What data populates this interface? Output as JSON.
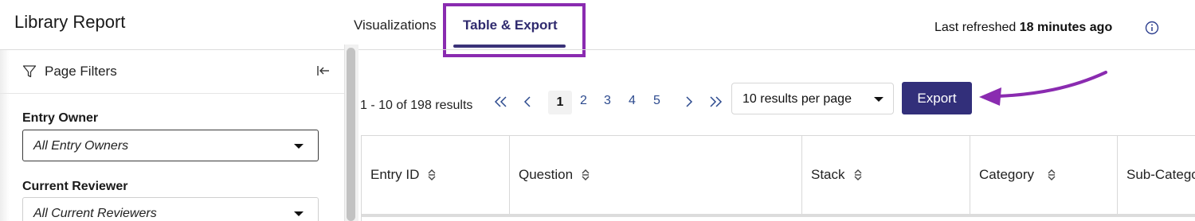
{
  "app": {
    "title": "Library Report"
  },
  "tabs": [
    {
      "label": "Visualizations",
      "active": false
    },
    {
      "label": "Table & Export",
      "active": true
    }
  ],
  "refresh": {
    "prefix": "Last refreshed",
    "value": "18 minutes ago"
  },
  "sidebar": {
    "filters_label": "Page Filters",
    "fields": [
      {
        "label": "Entry Owner",
        "value": "All Entry Owners"
      },
      {
        "label": "Current Reviewer",
        "value": "All Current Reviewers"
      }
    ]
  },
  "pagination": {
    "results_text": "1 - 10 of 198 results",
    "current_page": "1",
    "pages": [
      "2",
      "3",
      "4",
      "5"
    ],
    "per_page": "10 results per page"
  },
  "export_label": "Export",
  "table": {
    "columns": [
      "Entry ID",
      "Question",
      "Stack",
      "Category",
      "Sub-Catego"
    ]
  },
  "colors": {
    "accent": "#322f7a",
    "annotation": "#8a2bb0",
    "link": "#2c4a8e"
  }
}
